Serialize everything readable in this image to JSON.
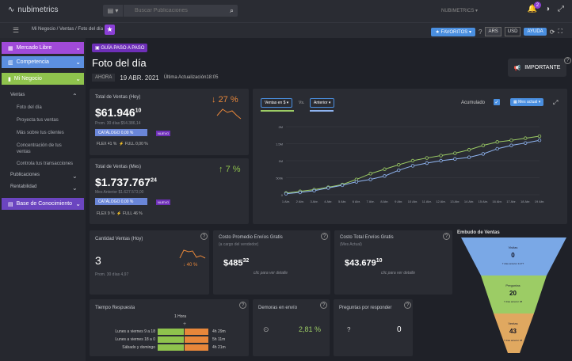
{
  "header": {
    "brand": "nubimetrics",
    "search_placeholder": "Buscar Publicaciones",
    "user": "NUBIMETRICS",
    "notif_count": "2"
  },
  "subbar": {
    "breadcrumb": "Mi Negocio / Ventas / Foto del día",
    "favorites": "FAVORITOS",
    "cur1": "ARS",
    "cur2": "USD",
    "help": "AYUDA"
  },
  "sidebar": {
    "mercado": "Mercado Libre",
    "competencia": "Competencia",
    "mi_negocio": "Mi Negocio",
    "ventas": "Ventas",
    "links": [
      "Foto del día",
      "Proyecta tus ventas",
      "Más sobre tus clientes",
      "Concentración de tus",
      "ventas",
      "Controla tus transacciones"
    ],
    "publicaciones": "Publicaciones",
    "rentabilidad": "Rentabilidad",
    "base": "Base de Conocimiento"
  },
  "page": {
    "guide": "GUÍA PASO A PASO",
    "title": "Foto del día",
    "today": "AHORA",
    "date": "19 ABR. 2021",
    "last_update": "Última Actualización18:05",
    "important": "IMPORTANTE"
  },
  "hoy": {
    "title": "Total de Ventas (Hoy)",
    "value": "$61.946",
    "cents": "10",
    "prom": "Prom. 30 días $54.386,14",
    "delta": "27 %",
    "catalogo": "CATÁLOGO 0,00 %",
    "nuevo": "NUEVO",
    "flex": "FLEX 41 %",
    "full": "FULL 0,00 %"
  },
  "mes": {
    "title": "Total de Ventas (Mes)",
    "value": "$1.737.767",
    "cents": "24",
    "prom": "Mes Anterior $1.627.573,00",
    "delta": "7 %",
    "catalogo": "CATÁLOGO 0,00 %",
    "nuevo": "NUEVO",
    "flex": "FLEX 9 %",
    "full": "FULL 46 %"
  },
  "chart_controls": {
    "ventas": "Ventas en $",
    "vs": "Vs.",
    "anterior": "Anterior",
    "acumulado": "Acumulado",
    "period": "Mes actual"
  },
  "chart_data": {
    "type": "line",
    "x": [
      "1 Abr.",
      "2 Abr.",
      "3 Abr.",
      "4 Abr.",
      "5 Abr.",
      "6 Abr.",
      "7 Abr.",
      "8 Abr.",
      "9 Abr.",
      "10 Abr.",
      "11 Abr.",
      "12 Abr.",
      "13 Abr.",
      "14 Abr.",
      "15 Abr.",
      "16 Abr.",
      "17 Abr.",
      "18 Abr.",
      "19 Abr."
    ],
    "series": [
      {
        "values": [
          0.05,
          0.1,
          0.15,
          0.22,
          0.3,
          0.45,
          0.62,
          0.75,
          0.88,
          1.0,
          1.08,
          1.15,
          1.22,
          1.32,
          1.45,
          1.55,
          1.6,
          1.66,
          1.72
        ]
      },
      {
        "values": [
          0.03,
          0.07,
          0.12,
          0.2,
          0.28,
          0.38,
          0.45,
          0.55,
          0.72,
          0.85,
          0.93,
          1.0,
          1.05,
          1.1,
          1.2,
          1.35,
          1.45,
          1.52,
          1.6
        ]
      }
    ],
    "yticks": [
      "0",
      "500k",
      "1M",
      "1.5M",
      "2M"
    ],
    "ylim": [
      0,
      2
    ],
    "colors": [
      "#9ccc65",
      "#8fb4f0"
    ]
  },
  "cantidad": {
    "title": "Cantidad Ventas (Hoy)",
    "value": "3",
    "prom": "Prom. 30 días 4,97",
    "delta": "40 %"
  },
  "costo_prom": {
    "title": "Costo Promedio Envíos Gratis",
    "sub": "(a cargo del vendedor)",
    "value": "$485",
    "cents": "32",
    "clic": "clic para ver detalle"
  },
  "costo_total": {
    "title": "Costo Total Envíos Gratis",
    "sub": "(Mes Actual)",
    "value": "$43.679",
    "cents": "10",
    "clic": "clic para ver detalle"
  },
  "embudo": {
    "title": "Embudo de Ventas",
    "visitas": "Visitas",
    "visitas_val": "0",
    "visitas_sub": "7 días anterior 3.277",
    "preguntas": "Preguntas",
    "preguntas_val": "20",
    "preguntas_sub": "7 días anterior 38",
    "ventas": "Ventas",
    "ventas_val": "43",
    "ventas_sub": "7 días anterior 48",
    "colors": [
      "#7aa8e6",
      "#9ccc65",
      "#e0a860"
    ]
  },
  "tiempo": {
    "title": "Tiempo Respuesta",
    "hora": "1 Hora",
    "rows": [
      {
        "label": "Lunes a viernes 9 a 18",
        "val": "4h 29m"
      },
      {
        "label": "Lunes a viernes 18 a 0",
        "val": "5h 11m"
      },
      {
        "label": "Sábado y domingo",
        "val": "4h 21m"
      }
    ]
  },
  "demoras": {
    "title": "Demoras en envío",
    "value": "2,81 %"
  },
  "preguntas_resp": {
    "title": "Preguntas por responder",
    "value": "0"
  }
}
